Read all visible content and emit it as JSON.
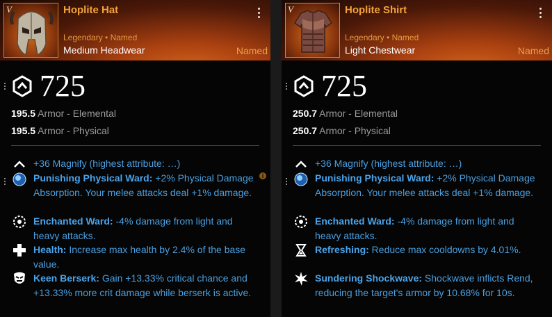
{
  "cards": [
    {
      "title": "Hoplite Hat",
      "tier": "V",
      "rarity": "Legendary • Named",
      "type": "Medium Headwear",
      "named_tag": "Named",
      "gear_score": "725",
      "armor_elemental_value": "195.5",
      "armor_elemental_label": " Armor - Elemental",
      "armor_physical_value": "195.5",
      "armor_physical_label": " Armor - Physical",
      "magnify": "+36 Magnify (highest attribute: …)",
      "perks": [
        {
          "name": "Punishing Physical Ward:",
          "desc": " +2% Physical Damage Absorption. Your melee attacks deal +1% damage.",
          "icon": "ward-orb-icon"
        },
        {
          "name": "Enchanted Ward:",
          "desc": " -4% damage from light and heavy attacks.",
          "icon": "enchanted-ward-icon"
        },
        {
          "name": "Health:",
          "desc": " Increase max health by 2.4% of the base value.",
          "icon": "health-cross-icon"
        },
        {
          "name": "Keen Berserk:",
          "desc": " Gain +13.33% critical chance and +13.33% more crit damage while berserk is active.",
          "icon": "berserk-mask-icon"
        }
      ]
    },
    {
      "title": "Hoplite Shirt",
      "tier": "V",
      "rarity": "Legendary • Named",
      "type": "Light Chestwear",
      "named_tag": "Named",
      "gear_score": "725",
      "armor_elemental_value": "250.7",
      "armor_elemental_label": " Armor - Elemental",
      "armor_physical_value": "250.7",
      "armor_physical_label": " Armor - Physical",
      "magnify": "+36 Magnify (highest attribute: …)",
      "perks": [
        {
          "name": "Punishing Physical Ward:",
          "desc": " +2% Physical Damage Absorption. Your melee attacks deal +1% damage.",
          "icon": "ward-orb-icon"
        },
        {
          "name": "Enchanted Ward:",
          "desc": " -4% damage from light and heavy attacks.",
          "icon": "enchanted-ward-icon"
        },
        {
          "name": "Refreshing:",
          "desc": " Reduce max cooldowns by 4.01%.",
          "icon": "hourglass-icon"
        },
        {
          "name": "Sundering Shockwave:",
          "desc": " Shockwave inflicts Rend, reducing the target's armor by 10.68% for 10s.",
          "icon": "shockwave-icon"
        }
      ]
    }
  ],
  "info_icon": "i",
  "colors": {
    "title": "#f2a43a",
    "perk": "#4a9fe0",
    "named": "#eaa24a"
  }
}
